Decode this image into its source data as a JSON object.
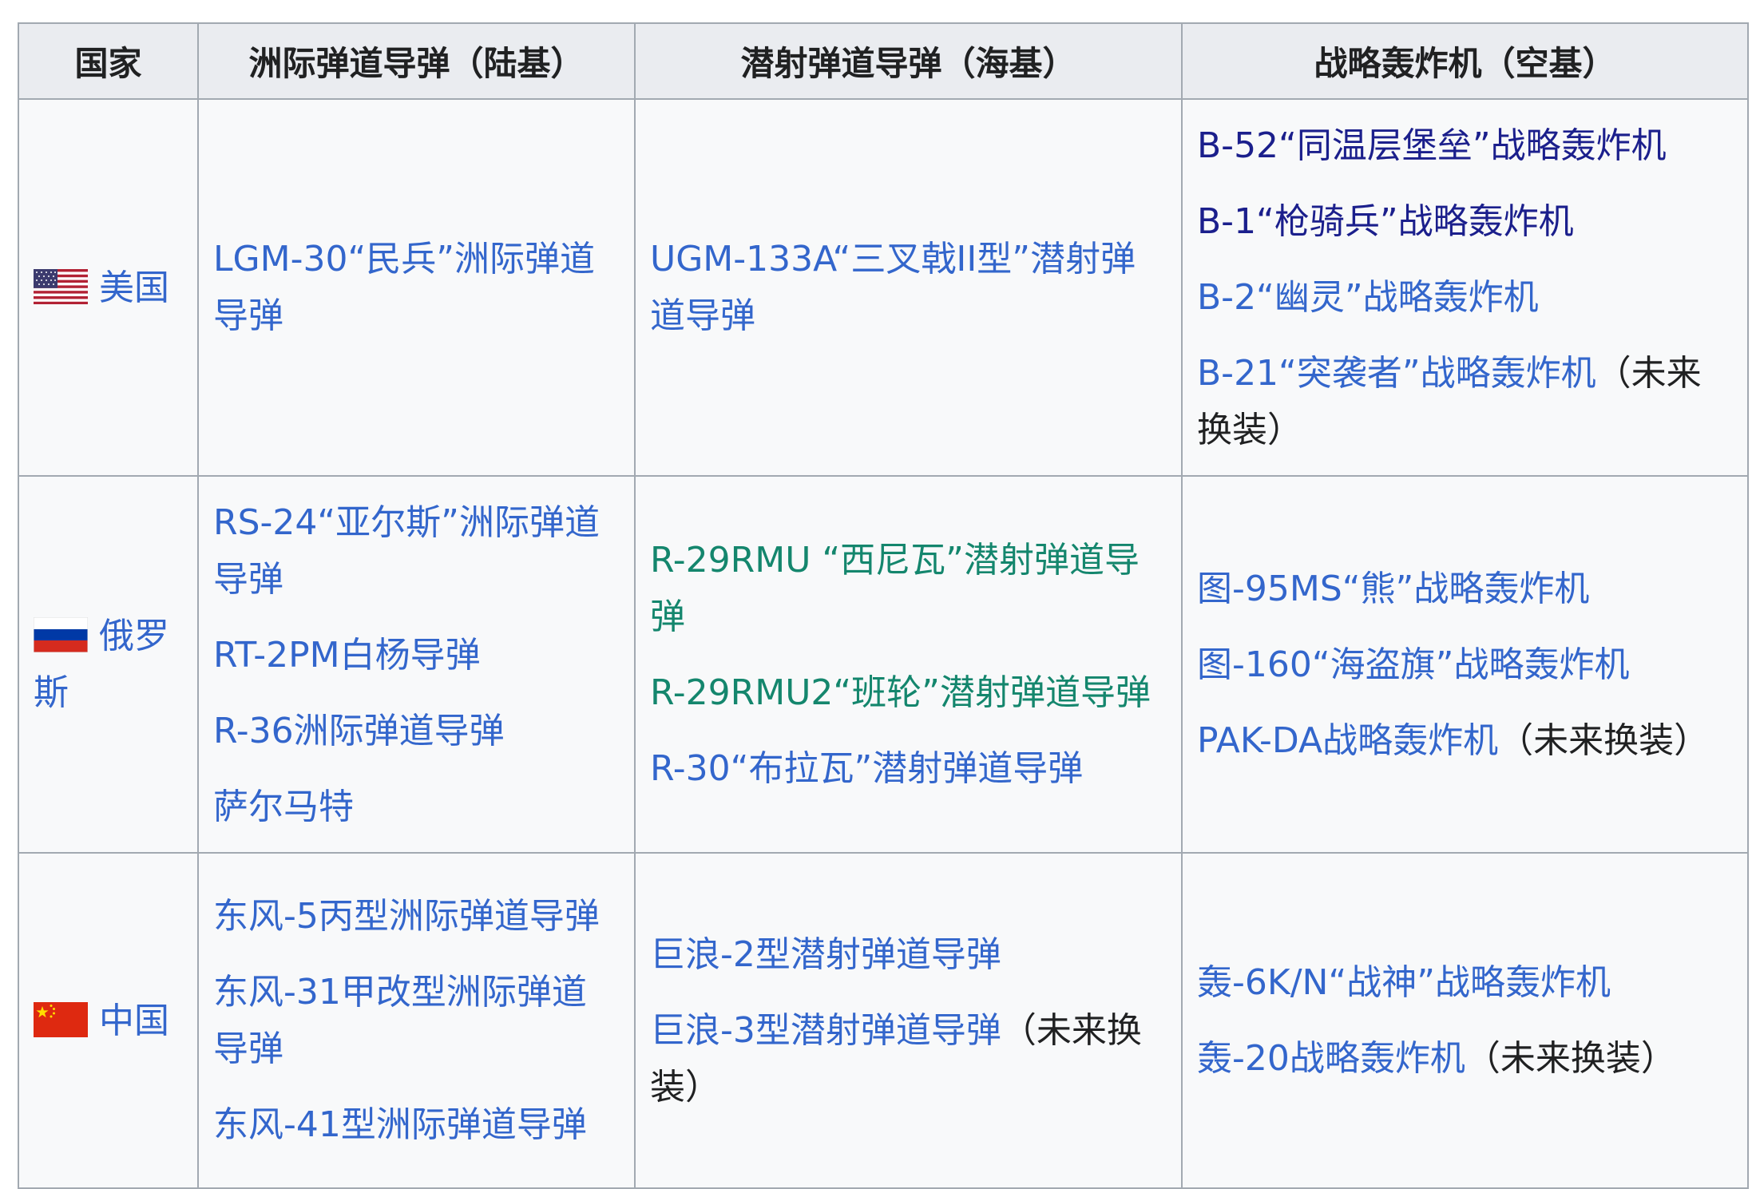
{
  "table": {
    "headers": {
      "country": "国家",
      "icbm": "洲际弹道导弹（陆基）",
      "slbm": "潜射弹道导弹（海基）",
      "bomber": "战略轰炸机（空基）"
    },
    "rows": {
      "us": {
        "country": "美国",
        "flag_icon": "us-flag-icon",
        "icbm": [
          "LGM-30“民兵”洲际弹道导弹"
        ],
        "slbm": [
          "UGM-133A“三叉戟II型”潜射弹道导弹"
        ],
        "bomber": [
          "B-52“同温层堡垒”战略轰炸机",
          "B-1“枪骑兵”战略轰炸机",
          "B-2“幽灵”战略轰炸机",
          "B-21“突袭者”战略轰炸机"
        ],
        "bomber_note": "（未来换装）"
      },
      "ru": {
        "country": "俄罗斯",
        "flag_icon": "russia-flag-icon",
        "icbm": [
          "RS-24“亚尔斯”洲际弹道导弹",
          "RT-2PM白杨导弹",
          "R-36洲际弹道导弹",
          "萨尔马特"
        ],
        "slbm": [
          "R-29RMU “西尼瓦”潜射弹道导弹",
          "R-29RMU2“班轮”潜射弹道导弹",
          "R-30“布拉瓦”潜射弹道导弹"
        ],
        "bomber": [
          "图-95MS“熊”战略轰炸机",
          "图-160“海盗旗”战略轰炸机",
          "PAK-DA战略轰炸机"
        ],
        "bomber_note": "（未来换装）"
      },
      "cn": {
        "country": "中国",
        "flag_icon": "china-flag-icon",
        "icbm": [
          "东风-5丙型洲际弹道导弹",
          "东风-31甲改型洲际弹道导弹",
          "东风-41型洲际弹道导弹"
        ],
        "slbm": [
          "巨浪-2型潜射弹道导弹",
          "巨浪-3型潜射弹道导弹"
        ],
        "slbm_note": "（未来换装）",
        "bomber": [
          "轰-6K/N“战神”战略轰炸机",
          "轰-20战略轰炸机"
        ],
        "bomber_note": "（未来换装）"
      }
    }
  },
  "colors": {
    "link": "#3366cc",
    "visited_link": "#1b1f8c",
    "interwiki_link": "#14866d",
    "text": "#202122",
    "header_bg": "#eaecf0",
    "cell_bg": "#f8f9fa",
    "border": "#a2a9b1"
  }
}
